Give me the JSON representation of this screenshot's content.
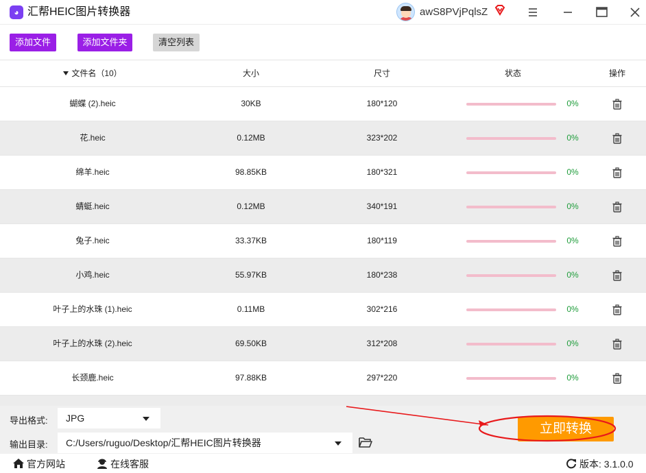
{
  "window": {
    "title": "汇帮HEIC图片转换器",
    "username": "awS8PVjPqlsZ"
  },
  "toolbar": {
    "add_file": "添加文件",
    "add_folder": "添加文件夹",
    "clear_list": "清空列表"
  },
  "table": {
    "headers": {
      "name": "文件名（10）",
      "size": "大小",
      "dimensions": "尺寸",
      "status": "状态",
      "actions": "操作"
    },
    "rows": [
      {
        "name": "蝴蝶 (2).heic",
        "size": "30KB",
        "dimensions": "180*120",
        "progress": "0%"
      },
      {
        "name": "花.heic",
        "size": "0.12MB",
        "dimensions": "323*202",
        "progress": "0%"
      },
      {
        "name": "绵羊.heic",
        "size": "98.85KB",
        "dimensions": "180*321",
        "progress": "0%"
      },
      {
        "name": "蜻蜓.heic",
        "size": "0.12MB",
        "dimensions": "340*191",
        "progress": "0%"
      },
      {
        "name": "兔子.heic",
        "size": "33.37KB",
        "dimensions": "180*119",
        "progress": "0%"
      },
      {
        "name": "小鸡.heic",
        "size": "55.97KB",
        "dimensions": "180*238",
        "progress": "0%"
      },
      {
        "name": "叶子上的水珠 (1).heic",
        "size": "0.11MB",
        "dimensions": "302*216",
        "progress": "0%"
      },
      {
        "name": "叶子上的水珠 (2).heic",
        "size": "69.50KB",
        "dimensions": "312*208",
        "progress": "0%"
      },
      {
        "name": "长颈鹿.heic",
        "size": "97.88KB",
        "dimensions": "297*220",
        "progress": "0%"
      }
    ]
  },
  "output": {
    "format_label": "导出格式:",
    "format_value": "JPG",
    "dir_label": "输出目录:",
    "dir_value": "C:/Users/ruguo/Desktop/汇帮HEIC图片转换器",
    "convert_button": "立即转换"
  },
  "statusbar": {
    "website": "官方网站",
    "service": "在线客服",
    "version": "版本:  3.1.0.0"
  },
  "colors": {
    "accent_purple": "#9a1fe6",
    "convert_orange": "#ff9a00",
    "progress_track": "#f3bccb",
    "percent_green": "#1e9c3a",
    "annotation_red": "#e8191b"
  }
}
